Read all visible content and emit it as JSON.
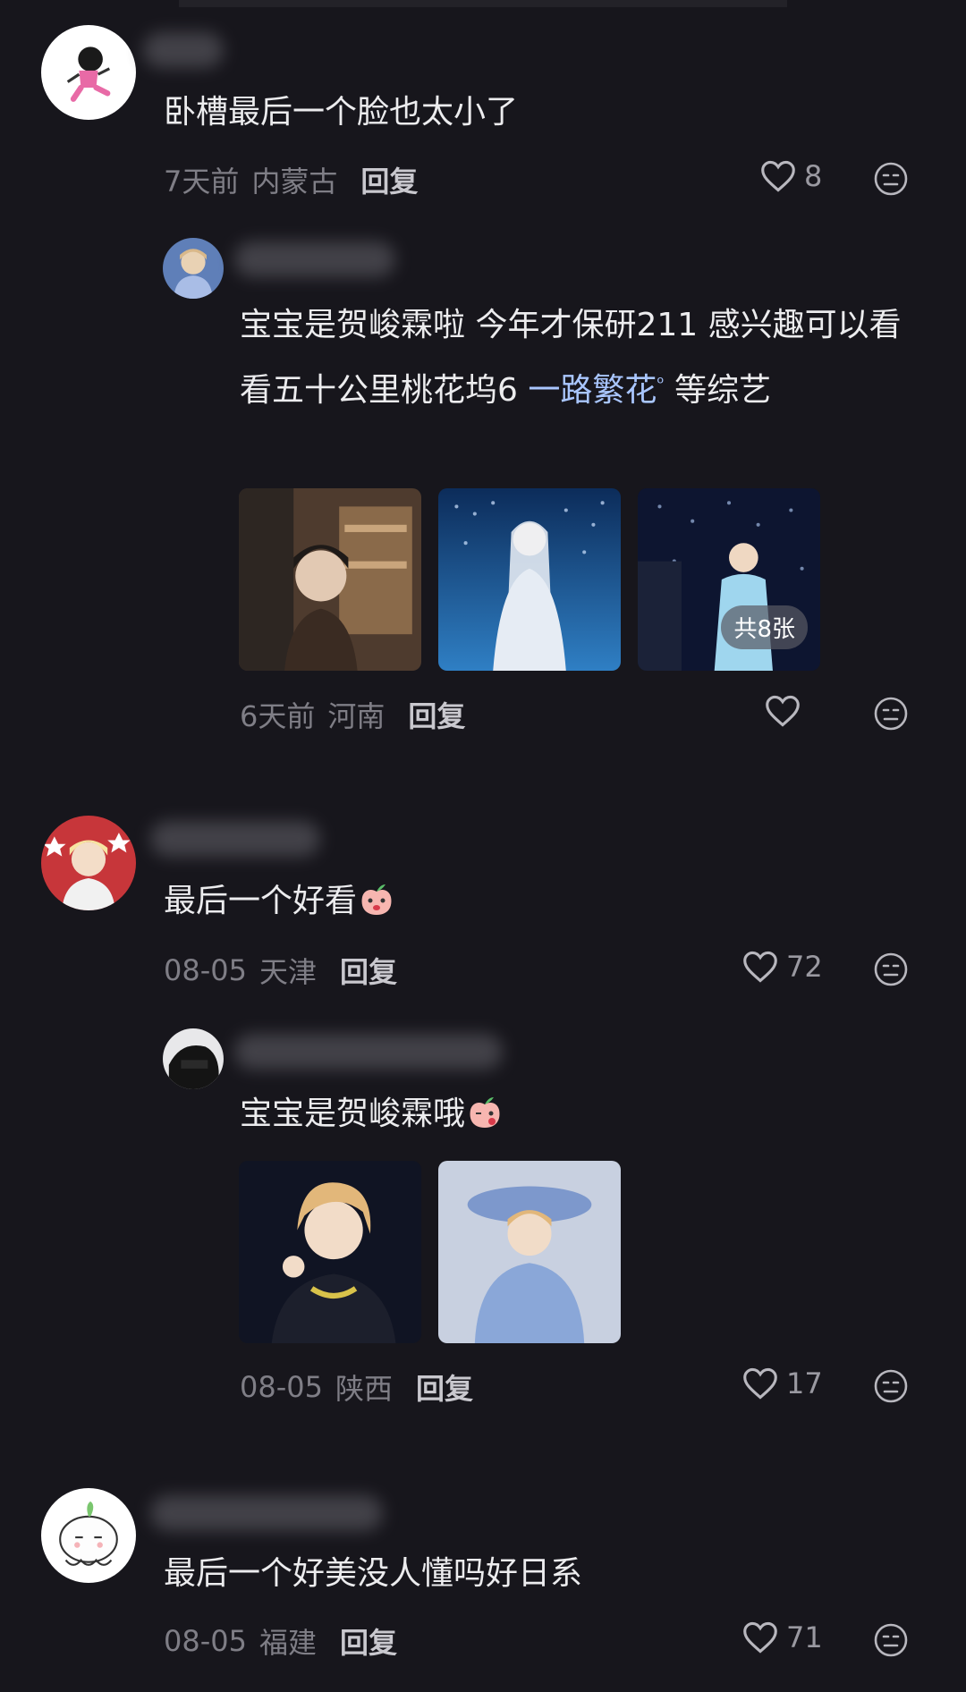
{
  "comments": [
    {
      "text": "卧槽最后一个脸也太小了",
      "time": "7天前",
      "location": "内蒙古",
      "reply_label": "回复",
      "likes": "8",
      "reply": {
        "text_before": "宝宝是贺峻霖啦 今年才保研211 感兴趣可以看看五十公里桃花坞6 ",
        "link": "一路繁花",
        "text_after": " 等综艺",
        "time": "6天前",
        "location": "河南",
        "reply_label": "回复",
        "image_count_badge": "共8张"
      }
    },
    {
      "text": "最后一个好看",
      "time": "08-05",
      "location": "天津",
      "reply_label": "回复",
      "likes": "72",
      "reply": {
        "text": "宝宝是贺峻霖哦",
        "time": "08-05",
        "location": "陕西",
        "reply_label": "回复",
        "likes": "17"
      }
    },
    {
      "text": "最后一个好美没人懂吗好日系",
      "time": "08-05",
      "location": "福建",
      "reply_label": "回复",
      "likes": "71"
    }
  ],
  "colors": {
    "background": "#17161c",
    "link": "#a9c6ff",
    "meta": "#7f7e86"
  },
  "icons": [
    "heart-outline-icon",
    "emoji-face-icon",
    "search-mark-icon"
  ]
}
